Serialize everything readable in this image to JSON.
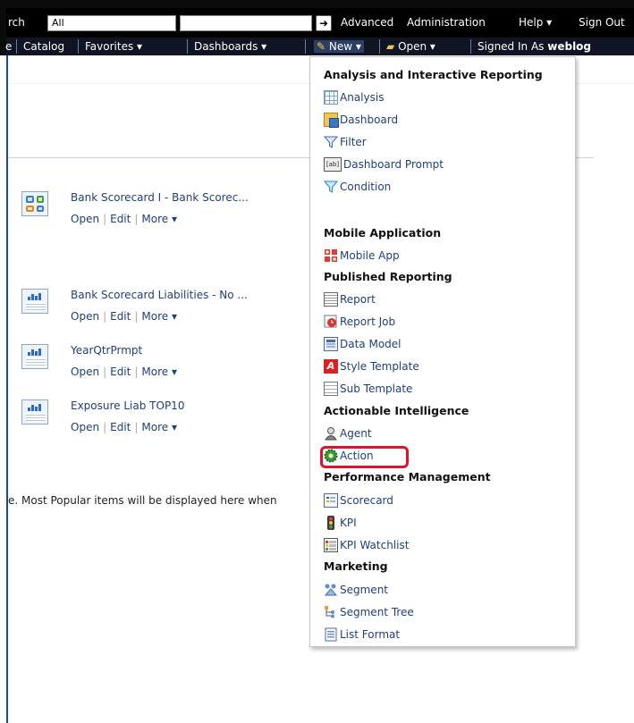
{
  "header": {
    "search_label": "rch",
    "search_scope": "All",
    "search_value": "",
    "go_icon": "arrow-right-icon",
    "links": [
      "Advanced",
      "Administration",
      "Help ▾",
      "Sign Out"
    ]
  },
  "nav": {
    "items": [
      "e",
      "Catalog",
      "Favorites ▾",
      "Dashboards ▾",
      "New ▾",
      "Open ▾"
    ],
    "signed_in_label": "Signed In As",
    "user": "weblog"
  },
  "recent_items": [
    {
      "title": "Bank Scorecard I - Bank Scorec...",
      "open": "Open",
      "edit": "Edit",
      "more": "More ▾",
      "type": "dashboard"
    },
    {
      "title": "Bank Scorecard Liabilities - No ...",
      "open": "Open",
      "edit": "Edit",
      "more": "More ▾",
      "type": "analysis"
    },
    {
      "title": "YearQtrPrmpt",
      "open": "Open",
      "edit": "Edit",
      "more": "More ▾",
      "type": "analysis"
    },
    {
      "title": "Exposure Liab TOP10",
      "open": "Open",
      "edit": "Edit",
      "more": "More ▾",
      "type": "analysis"
    }
  ],
  "most_popular_text": "e. Most Popular items will be displayed here when",
  "new_menu": {
    "sections": [
      {
        "header": "Analysis and Interactive Reporting",
        "items": [
          "Analysis",
          "Dashboard",
          "Filter",
          "Dashboard Prompt",
          "Condition"
        ]
      },
      {
        "header": "Mobile Application",
        "items": [
          "Mobile App"
        ]
      },
      {
        "header": "Published Reporting",
        "items": [
          "Report",
          "Report Job",
          "Data Model",
          "Style Template",
          "Sub Template"
        ]
      },
      {
        "header": "Actionable Intelligence",
        "items": [
          "Agent",
          "Action"
        ]
      },
      {
        "header": "Performance Management",
        "items": [
          "Scorecard",
          "KPI",
          "KPI Watchlist"
        ]
      },
      {
        "header": "Marketing",
        "items": [
          "Segment",
          "Segment Tree",
          "List Format"
        ]
      }
    ],
    "prompt_icon_text": "[ab]",
    "style_icon_text": "A",
    "highlighted_item": "Action",
    "highlight_color": "#e0112b"
  }
}
